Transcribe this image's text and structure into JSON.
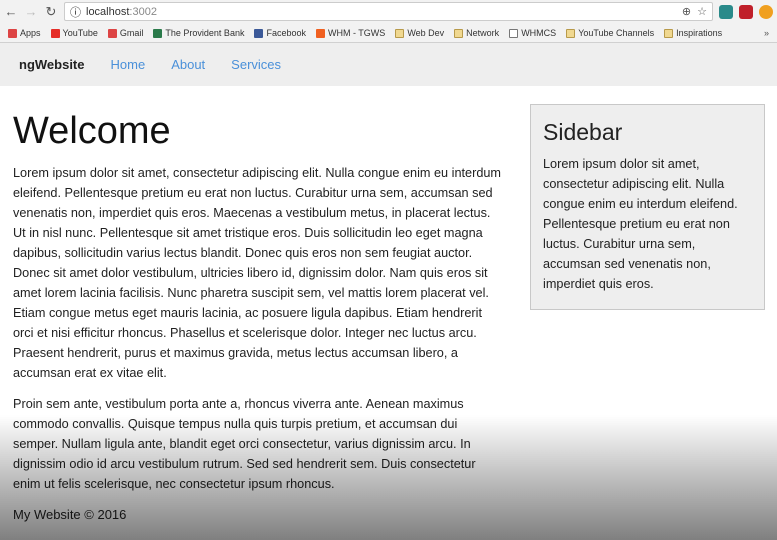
{
  "browser": {
    "url_host": "localhost",
    "url_port": ":3002",
    "bookmarks": [
      {
        "label": "Apps",
        "icon": "apps-grid-icon",
        "color": "#d44"
      },
      {
        "label": "YouTube",
        "icon": "youtube-icon",
        "color": "#e52d27"
      },
      {
        "label": "Gmail",
        "icon": "gmail-icon",
        "color": "#d44"
      },
      {
        "label": "The Provident Bank",
        "icon": "bank-icon",
        "color": "#2a7a4a"
      },
      {
        "label": "Facebook",
        "icon": "facebook-icon",
        "color": "#3b5998"
      },
      {
        "label": "WHM - TGWS",
        "icon": "whm-icon",
        "color": "#f06020"
      },
      {
        "label": "Web Dev",
        "icon": "folder-icon"
      },
      {
        "label": "Network",
        "icon": "folder-icon"
      },
      {
        "label": "WHMCS",
        "icon": "page-icon",
        "color": "#fff"
      },
      {
        "label": "YouTube Channels",
        "icon": "folder-icon"
      },
      {
        "label": "Inspirations",
        "icon": "folder-icon"
      }
    ],
    "more": "»"
  },
  "navbar": {
    "brand": "ngWebsite",
    "links": [
      "Home",
      "About",
      "Services"
    ],
    "link_color": "#4a90d9"
  },
  "main": {
    "title": "Welcome",
    "paragraphs": [
      "Lorem ipsum dolor sit amet, consectetur adipiscing elit. Nulla congue enim eu interdum eleifend. Pellentesque pretium eu erat non luctus. Curabitur urna sem, accumsan sed venenatis non, imperdiet quis eros. Maecenas a vestibulum metus, in placerat lectus. Ut in nisl nunc. Pellentesque sit amet tristique eros. Duis sollicitudin leo eget magna dapibus, sollicitudin varius lectus blandit. Donec quis eros non sem feugiat auctor. Donec sit amet dolor vestibulum, ultricies libero id, dignissim dolor. Nam quis eros sit amet lorem lacinia facilisis. Nunc pharetra suscipit sem, vel mattis lorem placerat vel. Etiam congue metus eget mauris lacinia, ac posuere ligula dapibus. Etiam hendrerit orci et nisi efficitur rhoncus. Phasellus et scelerisque dolor. Integer nec luctus arcu. Praesent hendrerit, purus et maximus gravida, metus lectus accumsan libero, a accumsan erat ex vitae elit.",
      "Proin sem ante, vestibulum porta ante a, rhoncus viverra ante. Aenean maximus commodo convallis. Quisque tempus nulla quis turpis pretium, et accumsan dui semper. Nullam ligula ante, blandit eget orci consectetur, varius dignissim arcu. In dignissim odio id arcu vestibulum rutrum. Sed sed hendrerit sem. Duis consectetur enim ut felis scelerisque, nec consectetur ipsum rhoncus."
    ]
  },
  "sidebar": {
    "title": "Sidebar",
    "text": "Lorem ipsum dolor sit amet, consectetur adipiscing elit. Nulla congue enim eu interdum eleifend. Pellentesque pretium eu erat non luctus. Curabitur urna sem, accumsan sed venenatis non, imperdiet quis eros."
  },
  "footer": {
    "text": "My Website © 2016"
  }
}
